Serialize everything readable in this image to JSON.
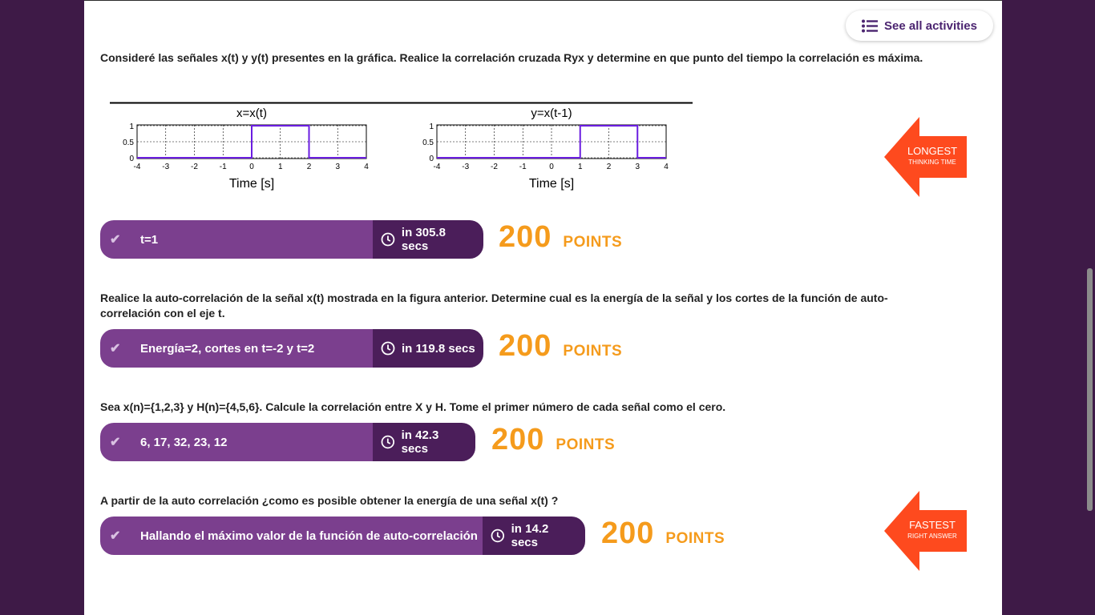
{
  "header": {
    "see_all_label": "See all activities"
  },
  "questions": [
    {
      "text": "Consideré las señales x(t) y y(t) presentes en la gráfica. Realice la correlación cruzada Ryx y determine en que punto del tiempo la correlación es máxima.",
      "answer": "t=1",
      "time": "in 305.8 secs",
      "points": "200",
      "points_label": "POINTS",
      "badge": {
        "title": "LONGEST",
        "subtitle": "THINKING TIME"
      }
    },
    {
      "text": "Realice la auto-correlación de la señal x(t) mostrada en la figura anterior. Determine cual es la energía de la señal y los cortes de la función de auto-correlación con el eje t.",
      "answer": "Energía=2, cortes en t=-2 y t=2",
      "time": "in 119.8 secs",
      "points": "200",
      "points_label": "POINTS"
    },
    {
      "text": "Sea x(n)={1,2,3} y H(n)={4,5,6}. Calcule la correlación entre X y H. Tome el primer número de cada señal como el cero.",
      "answer": "6, 17, 32, 23, 12",
      "time": "in 42.3 secs",
      "points": "200",
      "points_label": "POINTS"
    },
    {
      "text": "A partir de la auto correlación ¿como es posible obtener la energía de una señal x(t) ?",
      "answer": "Hallando el máximo valor de la función de auto-correlación",
      "time": "in 14.2 secs",
      "points": "200",
      "points_label": "POINTS",
      "badge": {
        "title": "FASTEST",
        "subtitle": "RIGHT ANSWER"
      }
    }
  ],
  "figure": {
    "plots": [
      {
        "title": "x=x(t)",
        "xlabel": "Time [s]",
        "pulse_start": 0,
        "pulse_end": 2
      },
      {
        "title": "y=x(t-1)",
        "xlabel": "Time [s]",
        "pulse_start": 1,
        "pulse_end": 3
      }
    ],
    "x_ticks": [
      "-4",
      "-3",
      "-2",
      "-1",
      "0",
      "1",
      "2",
      "3",
      "4"
    ],
    "y_ticks": [
      "1",
      "0.5",
      "0"
    ],
    "line_color": "#6a1de0"
  },
  "colors": {
    "answer_bg": "#7b3f8e",
    "time_bg": "#4b1e5a",
    "points": "#f59b1c",
    "badge": "#fe4a1e"
  }
}
